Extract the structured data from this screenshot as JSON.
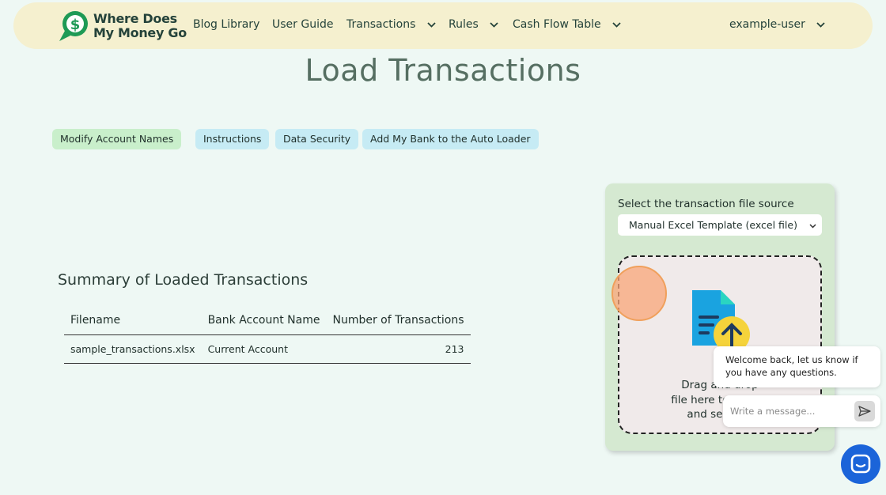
{
  "brand": {
    "name_line1": "Where Does",
    "name_line2": "My Money Go"
  },
  "nav": {
    "blog": "Blog Library",
    "guide": "User Guide",
    "transactions": "Transactions",
    "rules": "Rules",
    "cashflow": "Cash Flow Table",
    "user": "example-user"
  },
  "page": {
    "title": "Load Transactions"
  },
  "actions": {
    "modify": "Modify Account Names",
    "instructions": "Instructions",
    "security": "Data Security",
    "add_bank": "Add My Bank to the Auto Loader"
  },
  "summary": {
    "title": "Summary of Loaded Transactions",
    "columns": [
      "Filename",
      "Bank Account Name",
      "Number of Transactions"
    ],
    "rows": [
      {
        "filename": "sample_transactions.xlsx",
        "account": "Current Account",
        "count": "213"
      }
    ]
  },
  "upload": {
    "label": "Select the transaction file source",
    "selected": "Manual Excel Template (excel file)",
    "drop_line1": "Drag and drop",
    "drop_line2": "file here to upload",
    "drop_line3": "and select it"
  },
  "chat": {
    "welcome": "Welcome back, let us know if you have any questions.",
    "placeholder": "Write a message..."
  },
  "colors": {
    "background": "#eef8f4",
    "nav_bg": "#f5f0cf",
    "brand_green": "#1e9a55",
    "title": "#566f62",
    "pill_green": "#c9efcb",
    "pill_blue": "#c6ebf4",
    "panel_bg": "#d5e9d1",
    "chat_blue": "#1b64d9"
  },
  "icons": [
    "dollar-pin-logo-icon",
    "chevron-down-icon",
    "file-upload-icon",
    "send-icon",
    "chat-icon"
  ]
}
